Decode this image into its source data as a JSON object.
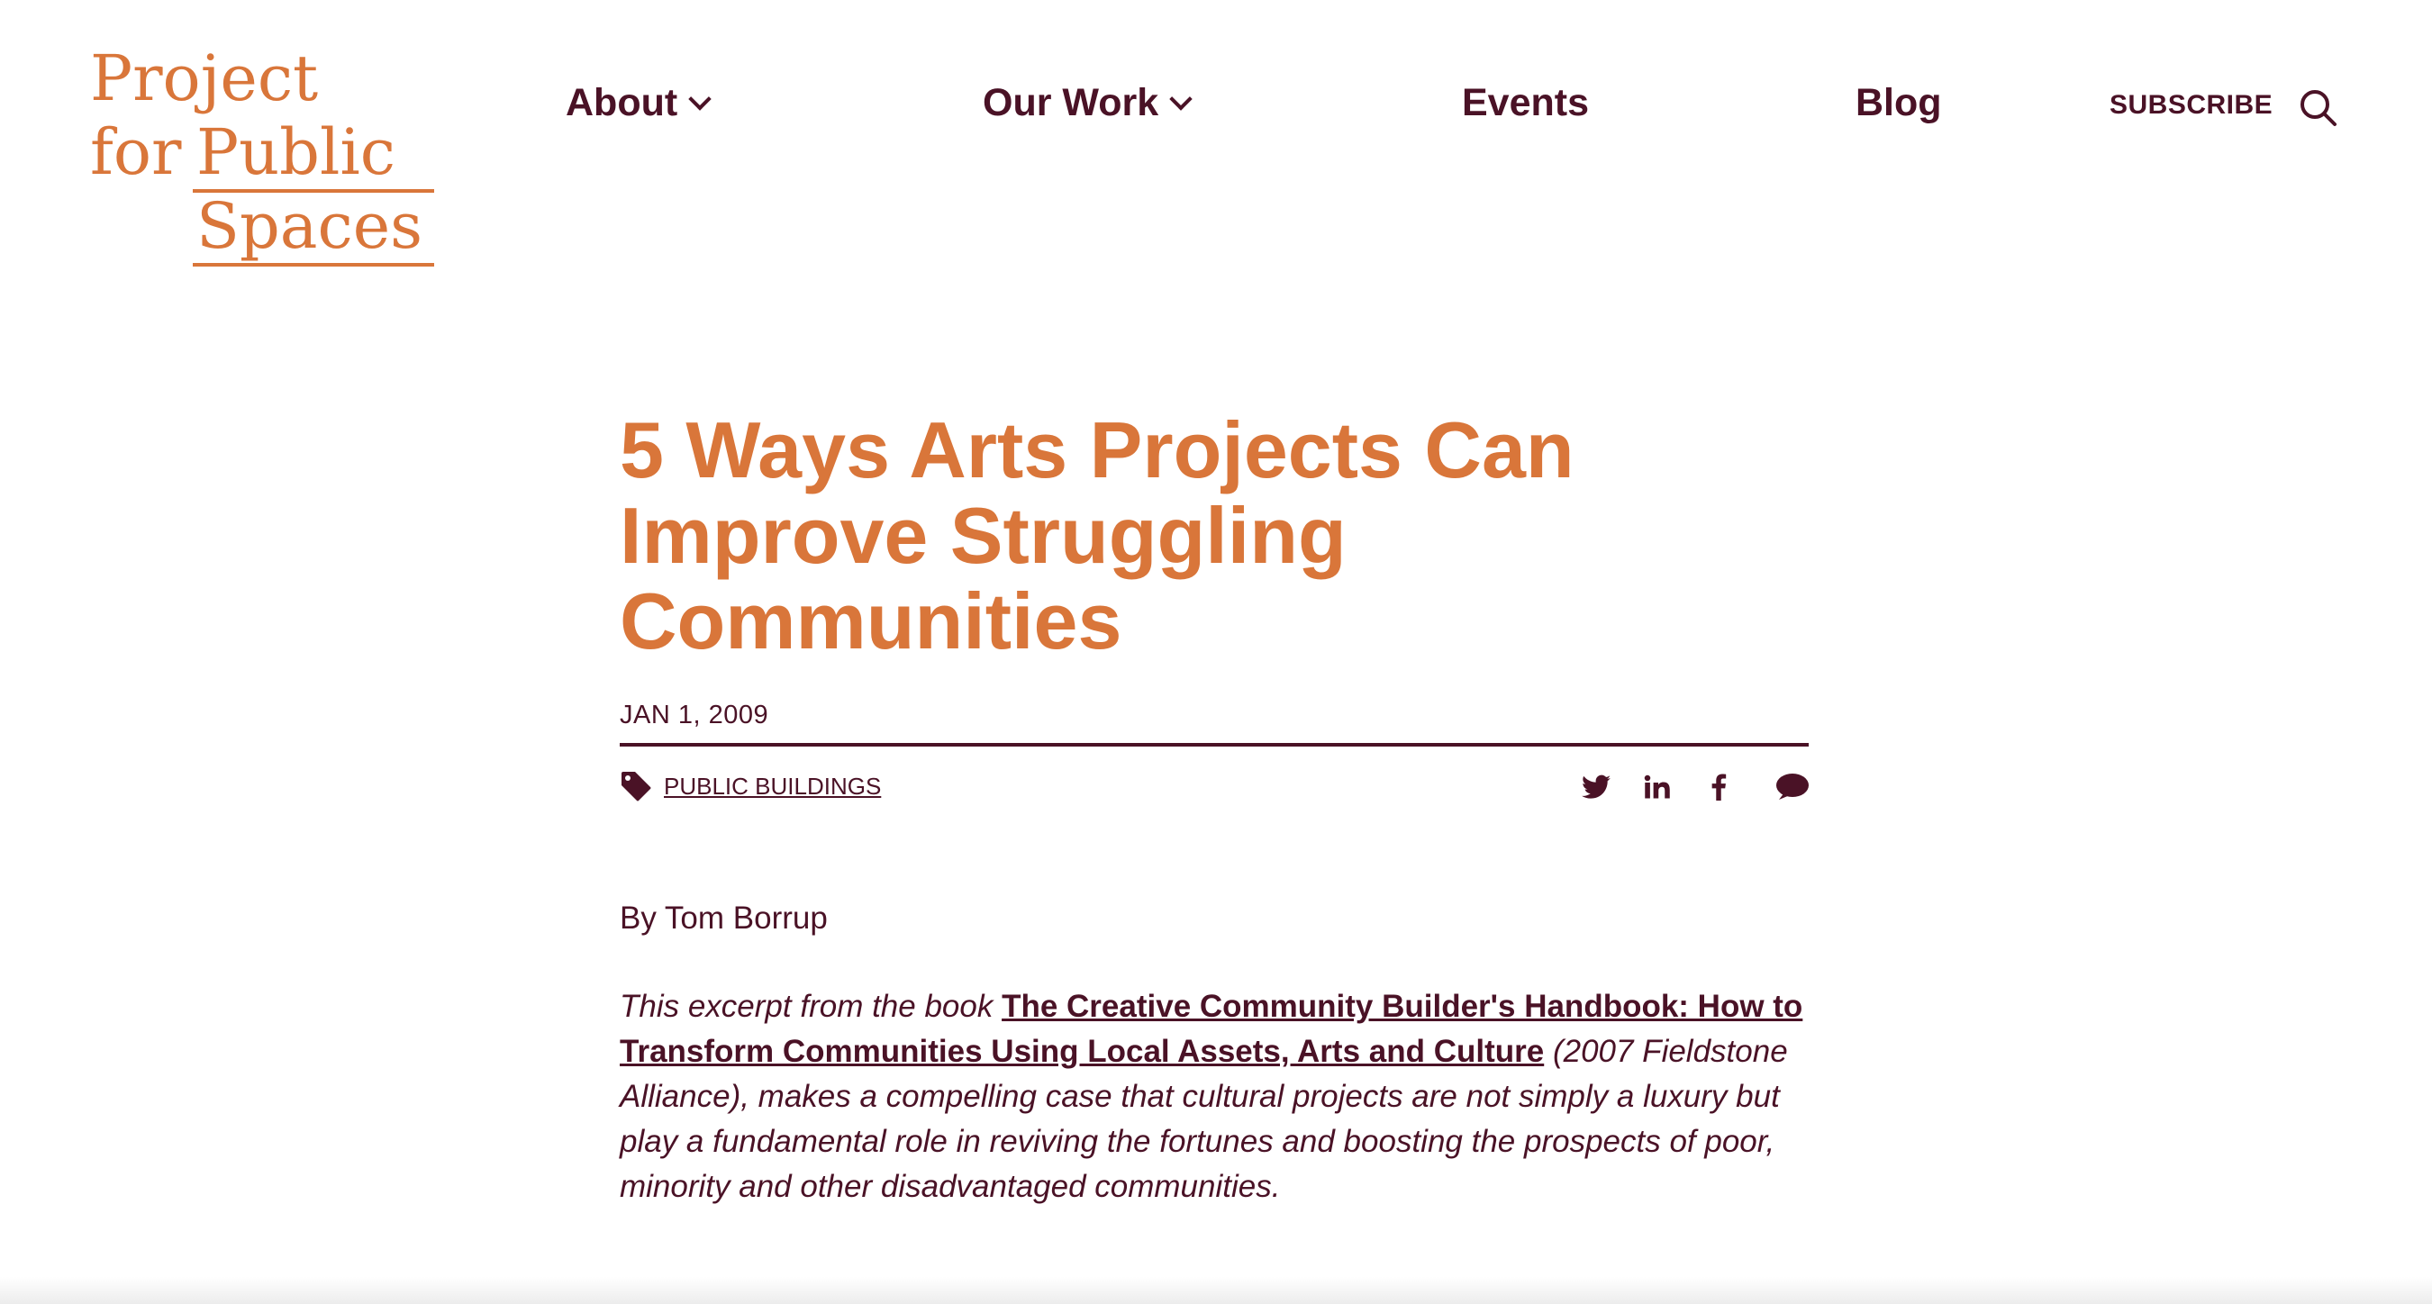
{
  "logo": {
    "line1": "Project",
    "line2a": "for",
    "line2b": "Public",
    "line3": "Spaces",
    "color": "#d9763a"
  },
  "nav": {
    "about": "About",
    "our_work": "Our Work",
    "events": "Events",
    "blog": "Blog",
    "subscribe": "SUBSCRIBE"
  },
  "article": {
    "title": "5 Ways Arts Projects Can Improve Struggling Communities",
    "date": "JAN 1, 2009",
    "tag": "PUBLIC BUILDINGS",
    "share_icons": [
      "twitter-icon",
      "linkedin-icon",
      "facebook-icon",
      "comment-icon"
    ],
    "byline": "By Tom Borrup",
    "excerpt_intro": "This excerpt from the book ",
    "excerpt_link": "The Creative Community Builder's Handbook: How to Transform Communities Using Local Assets, Arts and Culture",
    "excerpt_rest": " (2007 Fieldstone Alliance), makes a compelling case that cultural projects are not simply a luxury but play a fundamental role in reviving the fortunes and boosting the prospects of poor, minority and other disadvantaged communities."
  },
  "colors": {
    "brand_orange": "#d9763a",
    "text_maroon": "#4a1226"
  }
}
